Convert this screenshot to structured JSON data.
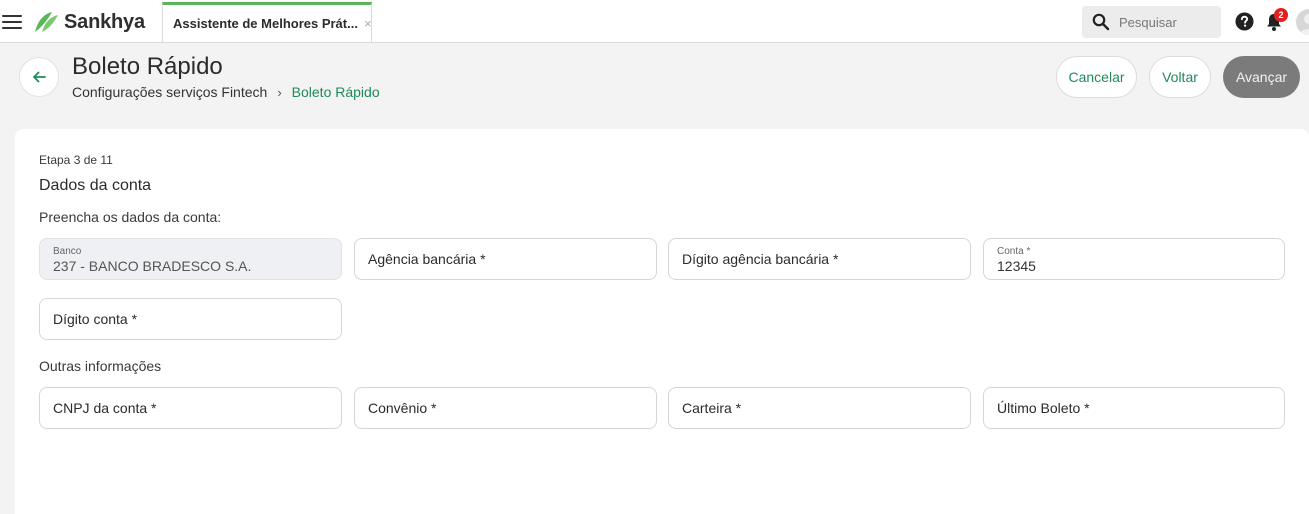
{
  "app": {
    "brand": "Sankhya",
    "brand_color": "#5bb65b",
    "accent": "#1f8a5b"
  },
  "topbar": {
    "tab_label": "Assistente de Melhores Prát...",
    "tab_close": "×",
    "search_placeholder": "Pesquisar",
    "notification_count": "2"
  },
  "header": {
    "title": "Boleto Rápido",
    "breadcrumb": {
      "parent": "Configurações serviços Fintech",
      "separator": "›",
      "current": "Boleto Rápido"
    },
    "buttons": {
      "cancel": "Cancelar",
      "back": "Voltar",
      "next": "Avançar"
    }
  },
  "form": {
    "step": "Etapa 3 de 11",
    "section_title": "Dados da conta",
    "instruction": "Preencha os dados da conta:",
    "banco": {
      "label": "Banco",
      "value": "237 - BANCO BRADESCO S.A."
    },
    "agencia": {
      "placeholder": "Agência bancária *"
    },
    "digito_agencia": {
      "placeholder": "Dígito agência bancária *"
    },
    "conta": {
      "label": "Conta *",
      "value": "12345"
    },
    "digito_conta": {
      "placeholder": "Dígito conta *"
    },
    "other_title": "Outras informações",
    "cnpj": {
      "placeholder": "CNPJ da conta *"
    },
    "convenio": {
      "placeholder": "Convênio *"
    },
    "carteira": {
      "placeholder": "Carteira *"
    },
    "ultimo_boleto": {
      "placeholder": "Último Boleto *"
    }
  }
}
